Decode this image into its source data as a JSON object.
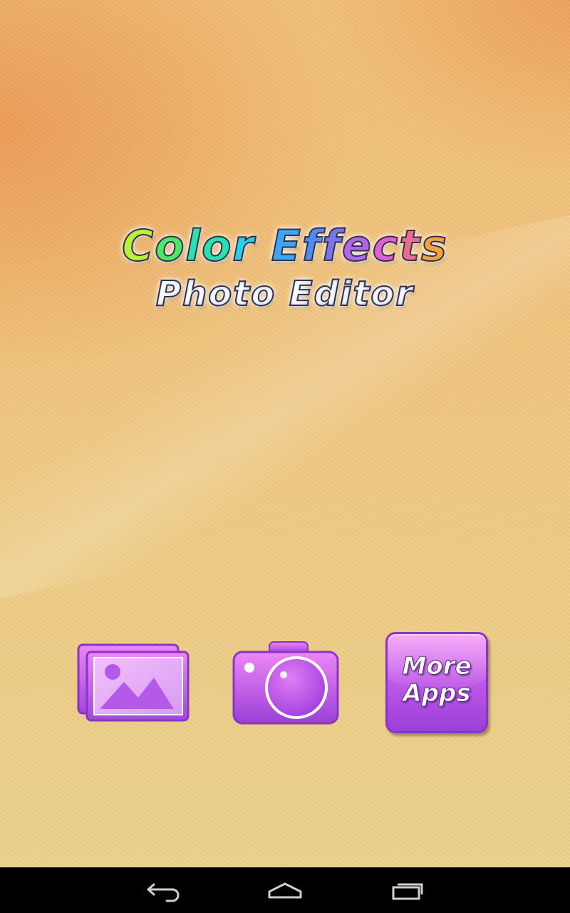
{
  "app": {
    "title_line1_glyphs": [
      "C",
      "o",
      "l",
      "o",
      "r",
      " ",
      "E",
      "f",
      "f",
      "e",
      "c",
      "t",
      "s"
    ],
    "title_line2": "Photo Editor"
  },
  "actions": {
    "gallery_icon": "gallery-icon",
    "camera_icon": "camera-icon",
    "more_apps_line1": "More",
    "more_apps_line2": "Apps"
  },
  "colors": {
    "button_purple": "#b055e6",
    "title_gradient_start": "#b7f23a",
    "title_gradient_end": "#f5a23a",
    "background_orange": "#f0c07a"
  },
  "nav": {
    "back_icon": "back-icon",
    "home_icon": "home-icon",
    "recents_icon": "recents-icon"
  }
}
